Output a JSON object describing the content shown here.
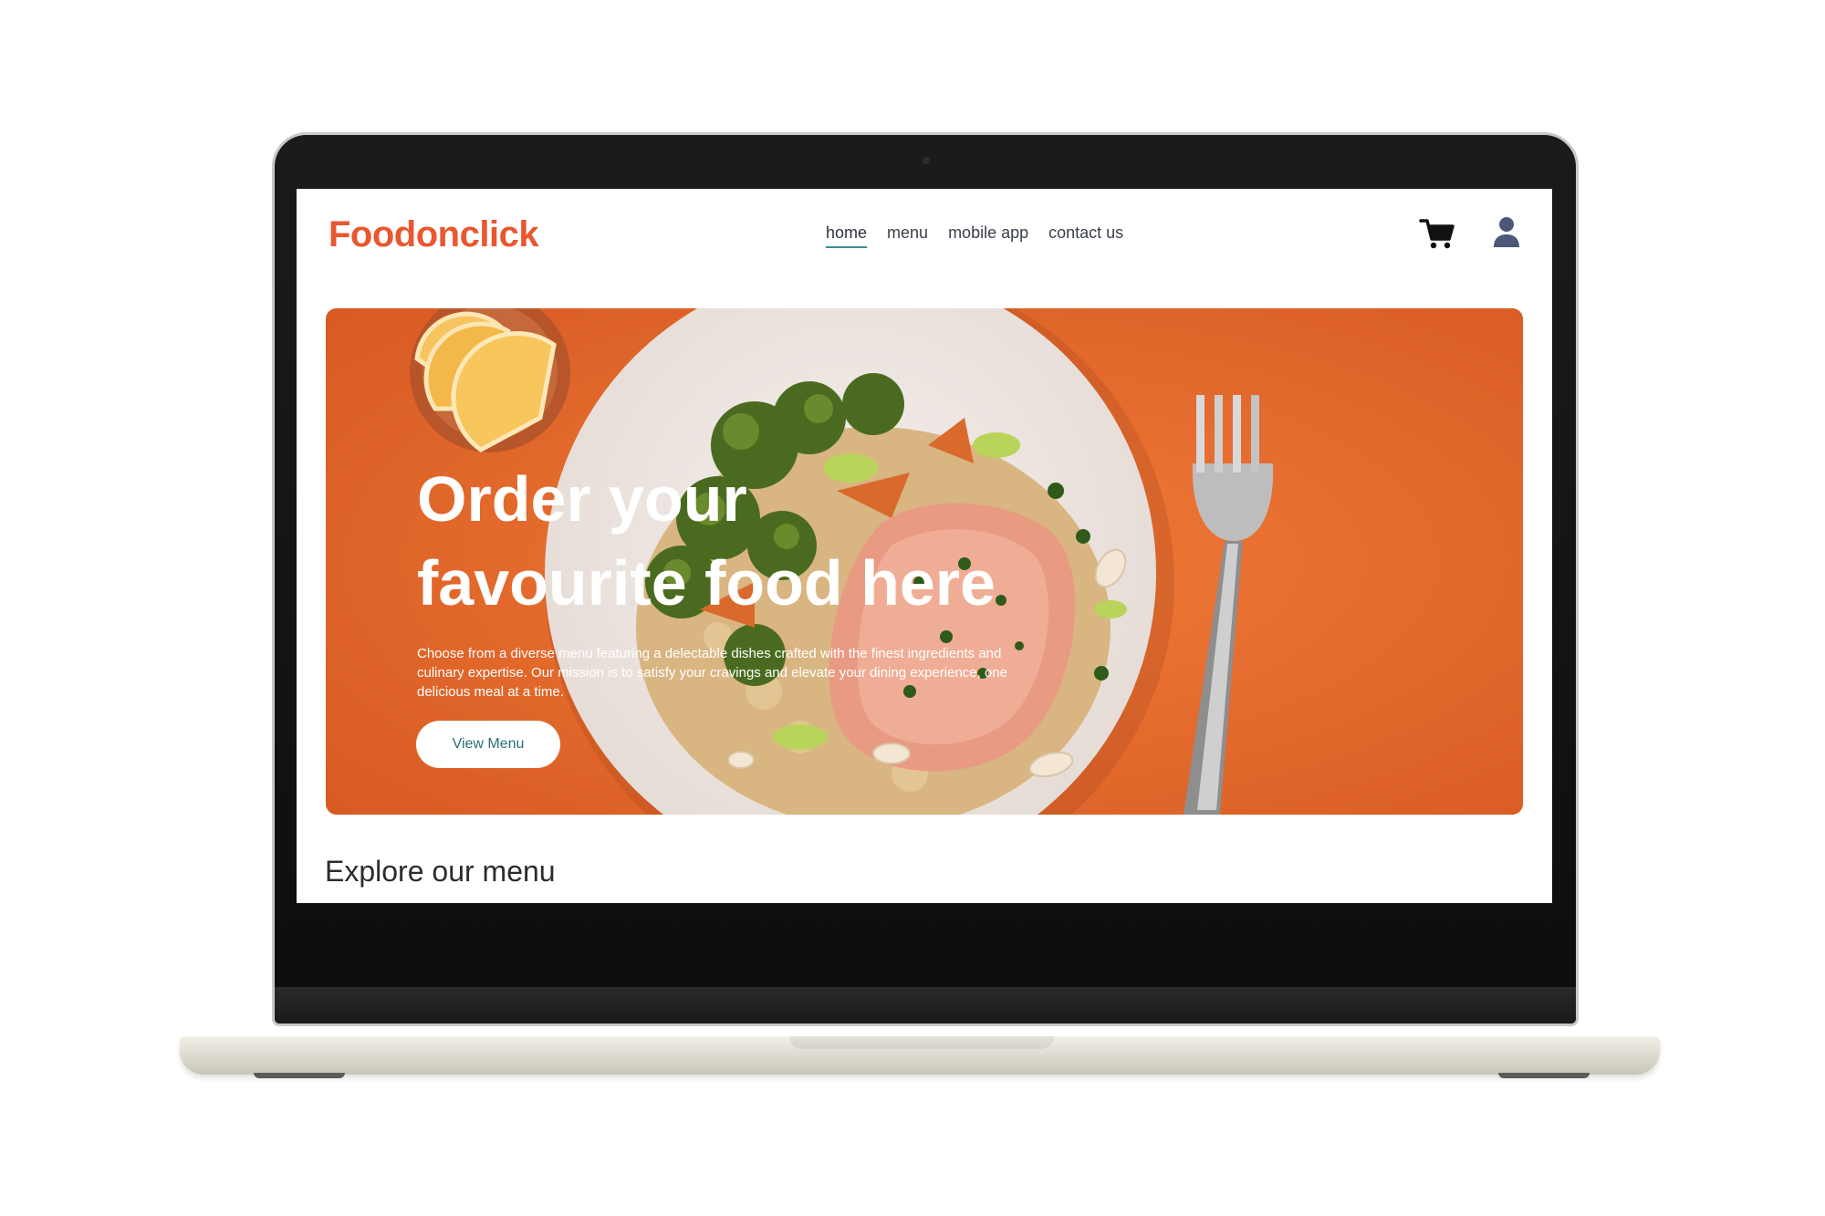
{
  "site": {
    "logo_text": "Foodonclick",
    "brand_color": "#e9572f",
    "accent_color": "#3a8c93"
  },
  "navbar": {
    "links": [
      {
        "label": "home",
        "active": true
      },
      {
        "label": "menu",
        "active": false
      },
      {
        "label": "mobile app",
        "active": false
      },
      {
        "label": "contact us",
        "active": false
      }
    ],
    "icons": [
      "cart-icon",
      "user-icon"
    ]
  },
  "hero": {
    "title_line1": "Order your",
    "title_line2": "favourite food here",
    "description": "Choose from a diverse menu featuring a delectable dishes crafted with the finest ingredients and culinary expertise. Our mission is to satisfy your cravings and elevate your dining experience, one delicious meal at a time.",
    "button_label": "View Menu",
    "background_color": "#e2682e"
  },
  "explore": {
    "heading": "Explore our menu"
  }
}
